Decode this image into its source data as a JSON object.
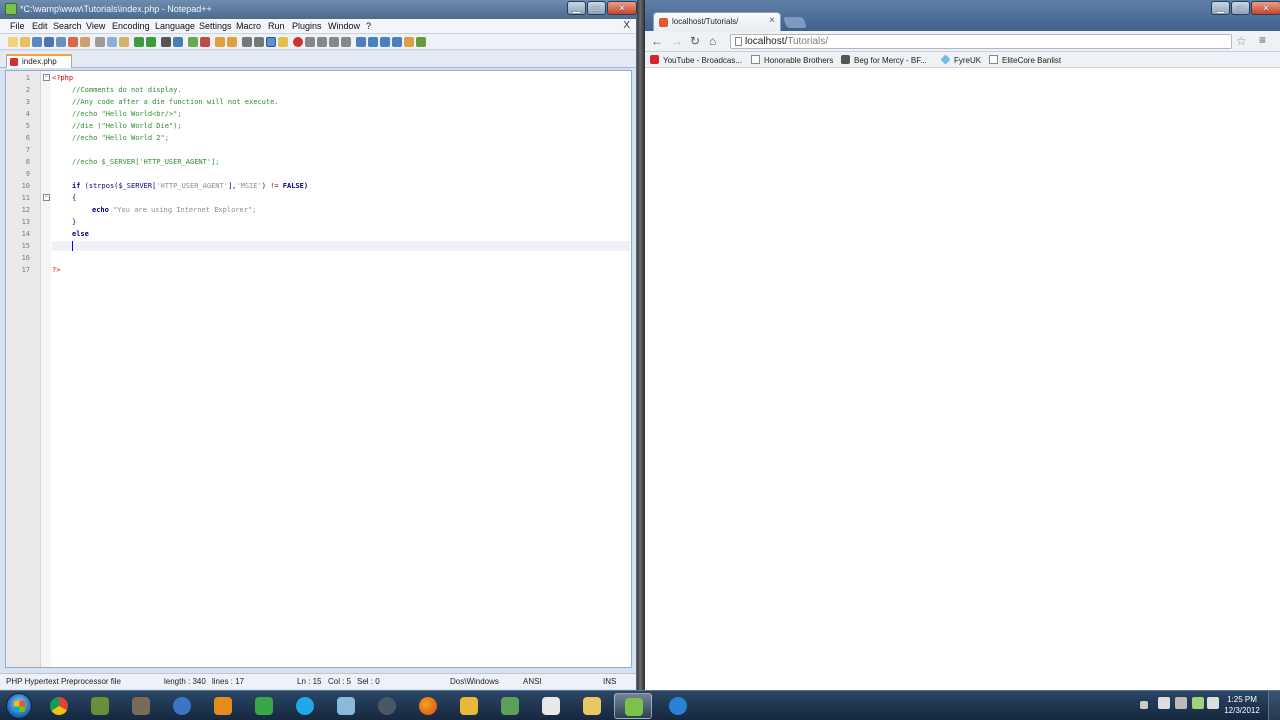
{
  "npp": {
    "title": "*C:\\wamp\\www\\Tutorials\\index.php - Notepad++",
    "menu": [
      "File",
      "Edit",
      "Search",
      "View",
      "Encoding",
      "Language",
      "Settings",
      "Macro",
      "Run",
      "Plugins",
      "Window",
      "?"
    ],
    "menu_close": "X",
    "tab_label": "index.php",
    "line_numbers": [
      "1",
      "2",
      "3",
      "4",
      "5",
      "6",
      "7",
      "8",
      "9",
      "10",
      "11",
      "12",
      "13",
      "14",
      "15",
      "16",
      "17"
    ],
    "code": {
      "l1": "<?php",
      "l2": "//Comments do not display.",
      "l3": "//Any code after a die function will not execute.",
      "l4": "//echo \"Hello World<br/>\";",
      "l5": "//die (\"Hello World Die\");",
      "l6": "//echo \"Hello World 2\";",
      "l8": "//echo $_SERVER['HTTP_USER_AGENT'];",
      "l10_kw": "if",
      "l10_a": " (strpos($_SERVER[",
      "l10_s1": "'HTTP_USER_AGENT'",
      "l10_b": "],",
      "l10_s2": "'MSIE'",
      "l10_c": ") ",
      "l10_op": "!=",
      "l10_d": " FALSE)",
      "l11": "{",
      "l12_kw": "echo",
      "l12_s": " \"You are using Internet Explorer\";",
      "l13": "}",
      "l14": "else",
      "l17": "?>"
    },
    "status": {
      "filetype": "PHP Hypertext Preprocessor file",
      "length": "length : 340",
      "lines": "lines : 17",
      "ln": "Ln : 15",
      "col": "Col : 5",
      "sel": "Sel : 0",
      "eol": "Dos\\Windows",
      "encoding": "ANSI",
      "mode": "INS"
    }
  },
  "chrome": {
    "tab_title": "localhost/Tutorials/",
    "tab_close": "×",
    "address_host": "localhost/",
    "address_path": "Tutorials/",
    "bookmarks": [
      "YouTube - Broadcas...",
      "Honorable Brothers",
      "Beg for Mercy - BF...",
      "FyreUK",
      "EliteCore Banlist"
    ]
  },
  "taskbar": {
    "time": "1:25 PM",
    "date": "12/3/2012"
  },
  "colors": {
    "npp_bg": "#d5e2f0",
    "comment": "#2b8f2b",
    "keyword": "#000080",
    "string": "#8c8c8c",
    "php_tag": "#d40000"
  }
}
